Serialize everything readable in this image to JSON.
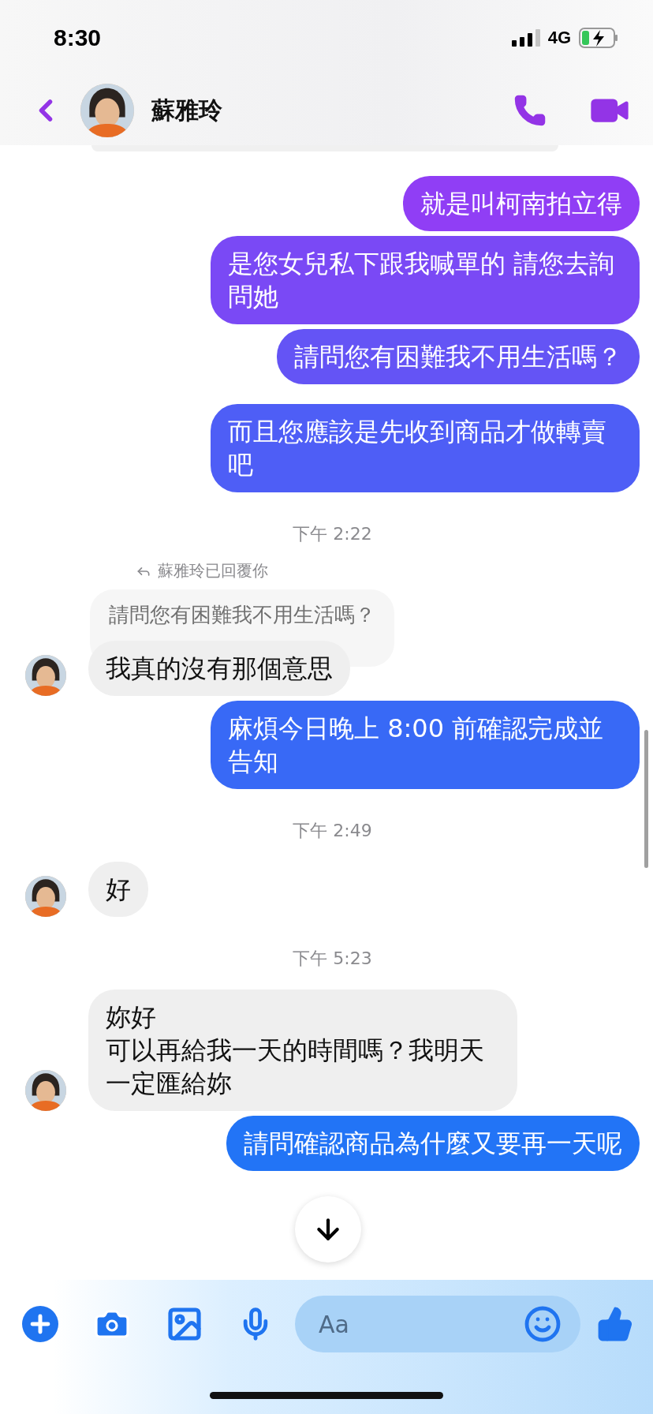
{
  "status_bar": {
    "time": "8:30",
    "network": "4G"
  },
  "header": {
    "name": "蘇雅玲"
  },
  "messages": [
    {
      "kind": "sent",
      "text": "就是叫柯南拍立得"
    },
    {
      "kind": "sent",
      "text": "是您女兒私下跟我喊單的 請您去詢問她"
    },
    {
      "kind": "sent",
      "text": "請問您有困難我不用生活嗎？"
    },
    {
      "kind": "sent",
      "text": "而且您應該是先收到商品才做轉賣吧"
    },
    {
      "kind": "time",
      "text": "下午 2:22"
    },
    {
      "kind": "reply",
      "label": "蘇雅玲已回覆你",
      "quote": "請問您有困難我不用生活嗎？"
    },
    {
      "kind": "received",
      "text": "我真的沒有那個意思"
    },
    {
      "kind": "sent",
      "text": "麻煩今日晚上 8:00 前確認完成並告知"
    },
    {
      "kind": "time",
      "text": "下午 2:49"
    },
    {
      "kind": "received",
      "text": "好"
    },
    {
      "kind": "time",
      "text": "下午 5:23"
    },
    {
      "kind": "received",
      "lines": [
        "妳好",
        "可以再給我一天的時間嗎？我明天一定匯給妳"
      ]
    },
    {
      "kind": "sent",
      "text": "請問確認商品為什麼又要再一天呢"
    }
  ],
  "composer": {
    "placeholder": "Aa"
  }
}
